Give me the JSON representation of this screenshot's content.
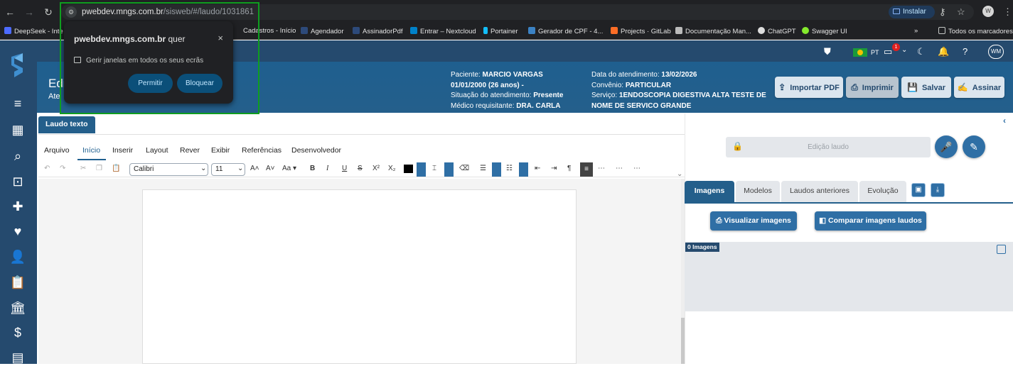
{
  "browser": {
    "url_host": "pwebdev.mngs.com.br",
    "url_path": "/sisweb/#/laudo/1031861",
    "install_label": "Instalar",
    "profile_initial": "W",
    "bookmarks": [
      "DeepSeek - Inte",
      "Cadastros - Início",
      "Agendador",
      "AssinadorPdf",
      "Entrar – Nextcloud",
      "Portainer",
      "Gerador de CPF - 4...",
      "Projects · GitLab",
      "Documentação Man...",
      "ChatGPT",
      "Swagger UI",
      "»",
      "Todos os marcadores"
    ]
  },
  "permission_popup": {
    "host": "pwebdev.mngs.com.br",
    "suffix": "quer",
    "description": "Gerir janelas em todos os seus ecrãs",
    "allow_label": "Permitir",
    "block_label": "Bloquear",
    "close": "×"
  },
  "topbar": {
    "lang": "PT",
    "notif_count": "1",
    "user_initials": "WM"
  },
  "header": {
    "title": "Edi",
    "subtitle": "Ate",
    "patient_label": "Paciente:",
    "patient_name": "MARCIO VARGAS",
    "birth": "01/01/2000 (26 anos) -",
    "status_label": "Situação do atendimento:",
    "status_value": "Presente",
    "doctor_label": "Médico requisitante:",
    "doctor_value": "DRA. CARLA",
    "date_label": "Data do atendimento:",
    "date_value": "13/02/2026",
    "plan_label": "Convênio:",
    "plan_value": "PARTICULAR",
    "service_label": "Serviço:",
    "service_value": "1ENDOSCOPIA DIGESTIVA ALTA TESTE DE",
    "service_value2": "NOME DE SERVICO GRANDE",
    "btn_import": "Importar PDF",
    "btn_print": "Imprimir",
    "btn_save": "Salvar",
    "btn_sign": "Assinar"
  },
  "editor": {
    "tab_label": "Laudo texto",
    "menus": [
      "Arquivo",
      "Início",
      "Inserir",
      "Layout",
      "Rever",
      "Exibir",
      "Referências",
      "Desenvolvedor"
    ],
    "font": "Calibri",
    "size": "11"
  },
  "right": {
    "edit_placeholder": "Edição laudo",
    "tabs": [
      "Imagens",
      "Modelos",
      "Laudos anteriores",
      "Evolução"
    ],
    "btn_view": "Visualizar imagens",
    "btn_compare": "Comparar imagens laudos",
    "img_count": "0 Imagens"
  },
  "colors": {
    "nav_dark": "#254a6e",
    "header_blue": "#245f8b",
    "accent": "#2f6fa5",
    "highlight": "#0f9d1f"
  }
}
